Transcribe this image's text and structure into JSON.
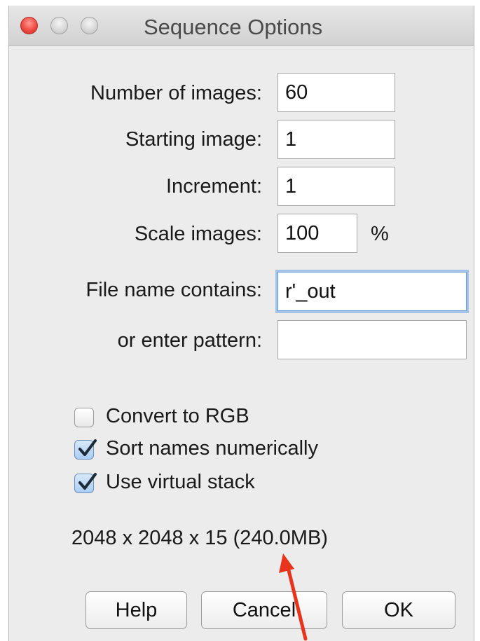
{
  "window": {
    "title": "Sequence Options"
  },
  "form": {
    "number_of_images": {
      "label": "Number of images:",
      "value": "60"
    },
    "starting_image": {
      "label": "Starting image:",
      "value": "1"
    },
    "increment": {
      "label": "Increment:",
      "value": "1"
    },
    "scale_images": {
      "label": "Scale images:",
      "value": "100",
      "unit": "%"
    },
    "file_name_contains": {
      "label": "File name contains:",
      "value": "r'_out"
    },
    "enter_pattern": {
      "label": "or enter pattern:",
      "value": ""
    }
  },
  "options": [
    {
      "label": "Convert to RGB",
      "checked": false
    },
    {
      "label": "Sort names numerically",
      "checked": true
    },
    {
      "label": "Use virtual stack",
      "checked": true
    }
  ],
  "info_text": "2048 x 2048 x 15 (240.0MB)",
  "buttons": {
    "help": "Help",
    "cancel": "Cancel",
    "ok": "OK"
  },
  "colors": {
    "close_button": "#ee4b43",
    "focus_ring": "#9fc3ea",
    "annotation_arrow": "#e8341c"
  },
  "icons": {
    "checkmark": "checkmark-icon",
    "annotation": "red-arrow-annotation"
  }
}
